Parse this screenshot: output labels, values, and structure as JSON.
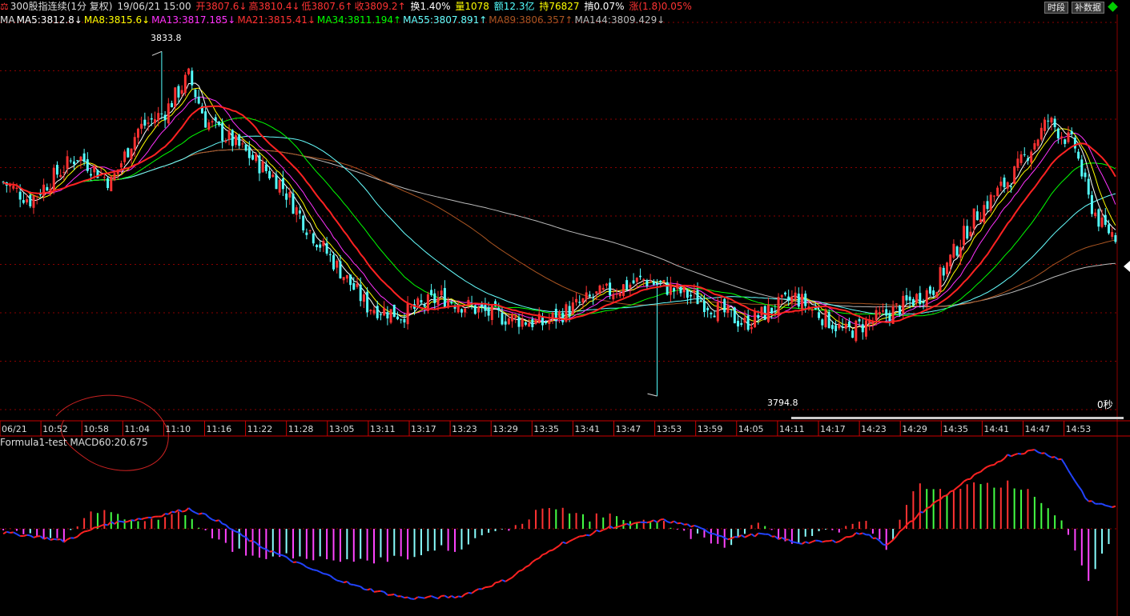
{
  "header": {
    "icon_glyph": "⚖",
    "name": "300股指连续(1分 复权)",
    "date": "19/06/21 15:00",
    "open": "开3807.6↓",
    "high": "高3810.4↓",
    "low": "低3807.6↑",
    "close": "收3809.2↑",
    "turnover": "换1.40%",
    "volume": "量1078",
    "amount": "额12.3亿",
    "hold": "持76827",
    "amplitude": "掯0.07%",
    "change": "涨(1.8)0.05%"
  },
  "buttons": {
    "period": "时段",
    "fill": "补数据"
  },
  "ma_legend": [
    {
      "text": "MA",
      "color": "#dddddd"
    },
    {
      "text": "MA5:3812.8↓",
      "color": "#ffffff"
    },
    {
      "text": "MA8:3815.6↓",
      "color": "#ffff00"
    },
    {
      "text": "MA13:3817.185↓",
      "color": "#ff33ff"
    },
    {
      "text": "MA21:3815.41↓",
      "color": "#ff3333"
    },
    {
      "text": "MA34:3811.194↑",
      "color": "#00ff00"
    },
    {
      "text": "MA55:3807.891↑",
      "color": "#66ffff"
    },
    {
      "text": "MA89:3806.357↑",
      "color": "#aa5522"
    },
    {
      "text": "MA144:3809.429↓",
      "color": "#bbbbbb"
    }
  ],
  "time_ticks": [
    "06/21",
    "10:52",
    "10:58",
    "11:04",
    "11:10",
    "11:16",
    "11:22",
    "11:28",
    "13:05",
    "13:11",
    "13:17",
    "13:23",
    "13:29",
    "13:35",
    "13:41",
    "13:47",
    "13:53",
    "13:59",
    "14:05",
    "14:11",
    "14:17",
    "14:23",
    "14:29",
    "14:35",
    "14:41",
    "14:47",
    "14:53"
  ],
  "high_label": "3833.8",
  "low_label": "3794.8",
  "countdown": "0秒",
  "macd_label": "Formula1-test MACD60:20.675",
  "colors": {
    "up": "#ff3232",
    "down": "#54ffff",
    "grid": "#8b0000",
    "ma5": "#ffffff",
    "ma8": "#ffff00",
    "ma13": "#ff33ff",
    "ma21": "#ff2222",
    "ma34": "#00ff00",
    "ma55": "#66ffff",
    "ma89": "#aa5522",
    "ma144": "#bbbbbb",
    "macd_pos_up": "#ff3232",
    "macd_pos_down": "#44ff44",
    "macd_neg_down": "#ff44ff",
    "macd_neg_up": "#88ffff",
    "macd_line_up": "#ff2222",
    "macd_line_down": "#2244ff"
  },
  "chart_data": {
    "type": "candlestick",
    "ylim": [
      3793,
      3836
    ],
    "high": 3833.8,
    "low": 3794.8,
    "close_keypoints": [
      [
        0,
        3819
      ],
      [
        8,
        3817
      ],
      [
        16,
        3820
      ],
      [
        22,
        3822
      ],
      [
        32,
        3819
      ],
      [
        40,
        3825
      ],
      [
        48,
        3827
      ],
      [
        55,
        3831
      ],
      [
        60,
        3826
      ],
      [
        70,
        3823
      ],
      [
        82,
        3819
      ],
      [
        90,
        3814
      ],
      [
        100,
        3809
      ],
      [
        108,
        3805
      ],
      [
        118,
        3804
      ],
      [
        130,
        3806
      ],
      [
        145,
        3804
      ],
      [
        160,
        3803
      ],
      [
        175,
        3806
      ],
      [
        190,
        3808
      ],
      [
        205,
        3806
      ],
      [
        220,
        3803
      ],
      [
        235,
        3806
      ],
      [
        250,
        3802
      ],
      [
        262,
        3804
      ],
      [
        276,
        3807
      ],
      [
        288,
        3815
      ],
      [
        300,
        3820
      ],
      [
        310,
        3826
      ],
      [
        318,
        3823
      ],
      [
        322,
        3817
      ],
      [
        326,
        3814
      ],
      [
        330,
        3813
      ]
    ],
    "macd_keypoints": [
      [
        0,
        -0.5
      ],
      [
        10,
        -1
      ],
      [
        18,
        -1.6
      ],
      [
        30,
        0.6
      ],
      [
        45,
        1.6
      ],
      [
        55,
        2.6
      ],
      [
        63,
        1.2
      ],
      [
        75,
        -2
      ],
      [
        90,
        -5
      ],
      [
        105,
        -7.5
      ],
      [
        120,
        -9
      ],
      [
        135,
        -8.8
      ],
      [
        150,
        -6.5
      ],
      [
        165,
        -2
      ],
      [
        180,
        0.2
      ],
      [
        196,
        1.1
      ],
      [
        204,
        0.4
      ],
      [
        215,
        -1.2
      ],
      [
        225,
        -0.7
      ],
      [
        236,
        -1.8
      ],
      [
        247,
        -1.6
      ],
      [
        255,
        -0.4
      ],
      [
        262,
        -2.1
      ],
      [
        272,
        2
      ],
      [
        285,
        6
      ],
      [
        298,
        9.5
      ],
      [
        306,
        10.2
      ],
      [
        314,
        9
      ],
      [
        322,
        3.5
      ],
      [
        330,
        2.8
      ]
    ],
    "macd_ylim": [
      -12,
      11
    ]
  }
}
